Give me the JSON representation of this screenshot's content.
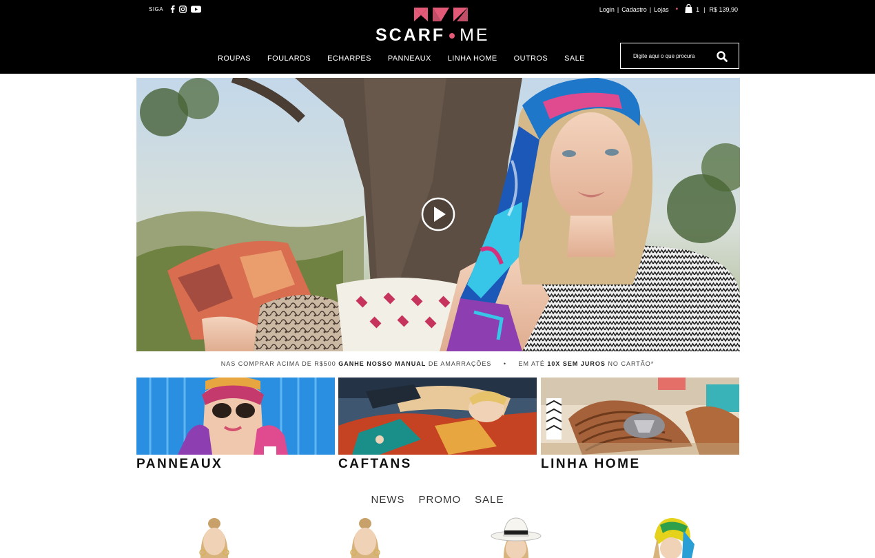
{
  "header": {
    "follow_label": "SIGA",
    "social": [
      "facebook-icon",
      "instagram-icon",
      "youtube-icon"
    ],
    "login": "Login",
    "signup": "Cadastro",
    "stores": "Lojas",
    "separator": "|",
    "cart_count": "1",
    "cart_total": "R$ 139,90",
    "logo_primary": "SCARF",
    "logo_secondary": "ME",
    "nav": [
      "ROUPAS",
      "FOULARDS",
      "ECHARPES",
      "PANNEAUX",
      "LINHA HOME",
      "OUTROS",
      "SALE"
    ],
    "search_placeholder": "Digite aqui o que procura"
  },
  "promo": {
    "part1": "NAS COMPRAR ACIMA DE R$500",
    "part1_bold": "GANHE NOSSO MANUAL",
    "part1_end": "DE AMARRAÇÕES",
    "bullet": "•",
    "part2": "EM ATÉ",
    "part2_bold": "10X SEM JUROS",
    "part2_end": "NO CARTÃO*"
  },
  "categories": [
    {
      "title": "PANNEAUX"
    },
    {
      "title": "CAFTANS"
    },
    {
      "title": "LINHA HOME"
    }
  ],
  "tabs": [
    "NEWS",
    "PROMO",
    "SALE"
  ],
  "colors": {
    "header_bg": "#000000",
    "accent_pink": "#e35a78"
  }
}
